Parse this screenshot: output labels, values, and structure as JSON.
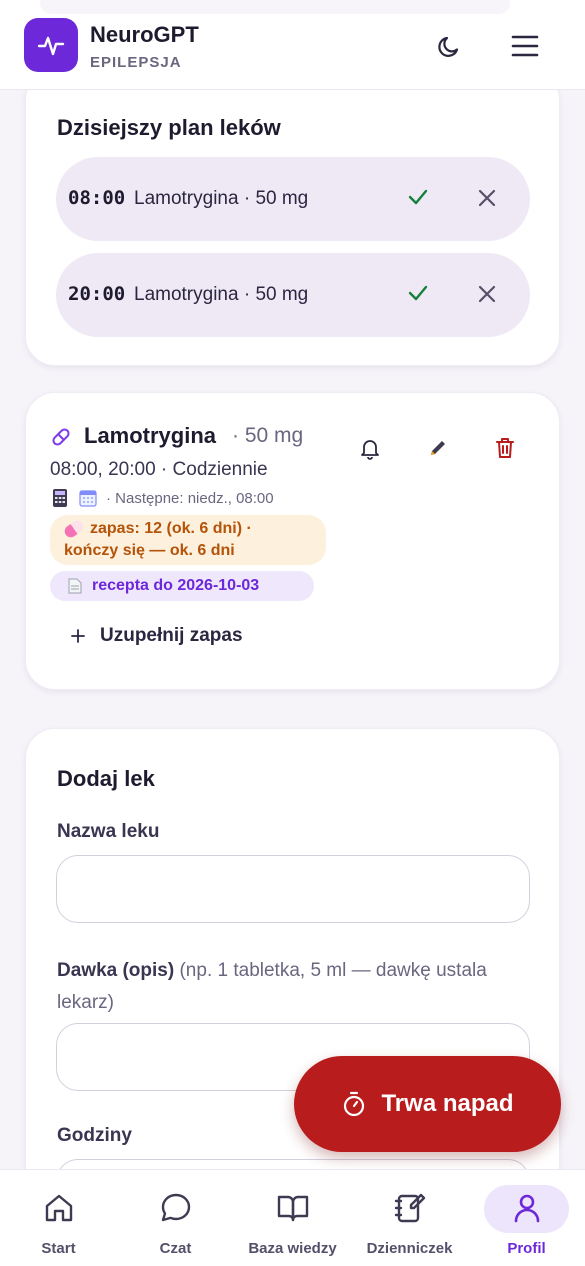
{
  "header": {
    "title": "NeuroGPT",
    "subtitle": "EPILEPSJA",
    "logo_icon": "pulse-icon",
    "theme_icon": "moon-icon",
    "menu_icon": "hamburger-menu-icon",
    "brand_color": "#6d28d9"
  },
  "plan": {
    "title": "Dzisiejszy plan leków",
    "rows": [
      {
        "time": "08:00",
        "label": "Lamotrygina · 50 mg"
      },
      {
        "time": "20:00",
        "label": "Lamotrygina · 50 mg"
      }
    ]
  },
  "medication": {
    "name": "Lamotrygina",
    "dose": "· 50 mg",
    "schedule": "08:00, 20:00 · Codziennie",
    "next": "· Następne: niedz., 08:00",
    "stock_line1": "zapas: 12 (ok. 6 dni) ·",
    "stock_line2": "kończy się — ok. 6 dni",
    "prescription": "recepta do 2026-10-03",
    "refill_label": "Uzupełnij zapas"
  },
  "add_form": {
    "title": "Dodaj lek",
    "name_label": "Nazwa leku",
    "dose_label": "Dawka (opis)",
    "dose_hint": " (np. 1 tabletka, 5 ml — dawkę ustala lekarz)",
    "hours_label": "Godziny"
  },
  "fab": {
    "label": "Trwa napad",
    "icon": "stopwatch-icon",
    "color": "#b91c1c"
  },
  "nav": {
    "items": [
      {
        "label": "Start",
        "icon": "home-icon"
      },
      {
        "label": "Czat",
        "icon": "chat-icon"
      },
      {
        "label": "Baza wiedzy",
        "icon": "book-icon"
      },
      {
        "label": "Dzienniczek",
        "icon": "journal-icon"
      },
      {
        "label": "Profil",
        "icon": "user-icon"
      }
    ],
    "active": "Profil"
  }
}
